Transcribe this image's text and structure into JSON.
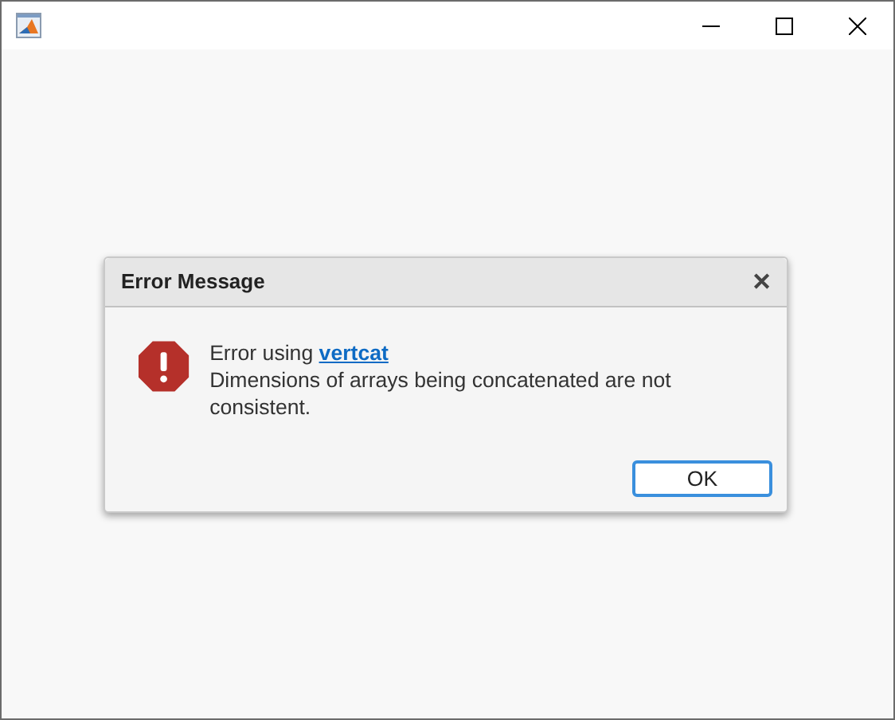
{
  "dialog": {
    "title": "Error Message",
    "close": "✕",
    "lead": "Error using",
    "link": "vertcat",
    "message": "Dimensions of arrays being concatenated are not consistent.",
    "buttons": [
      {
        "label": "OK",
        "selected": true
      }
    ]
  }
}
